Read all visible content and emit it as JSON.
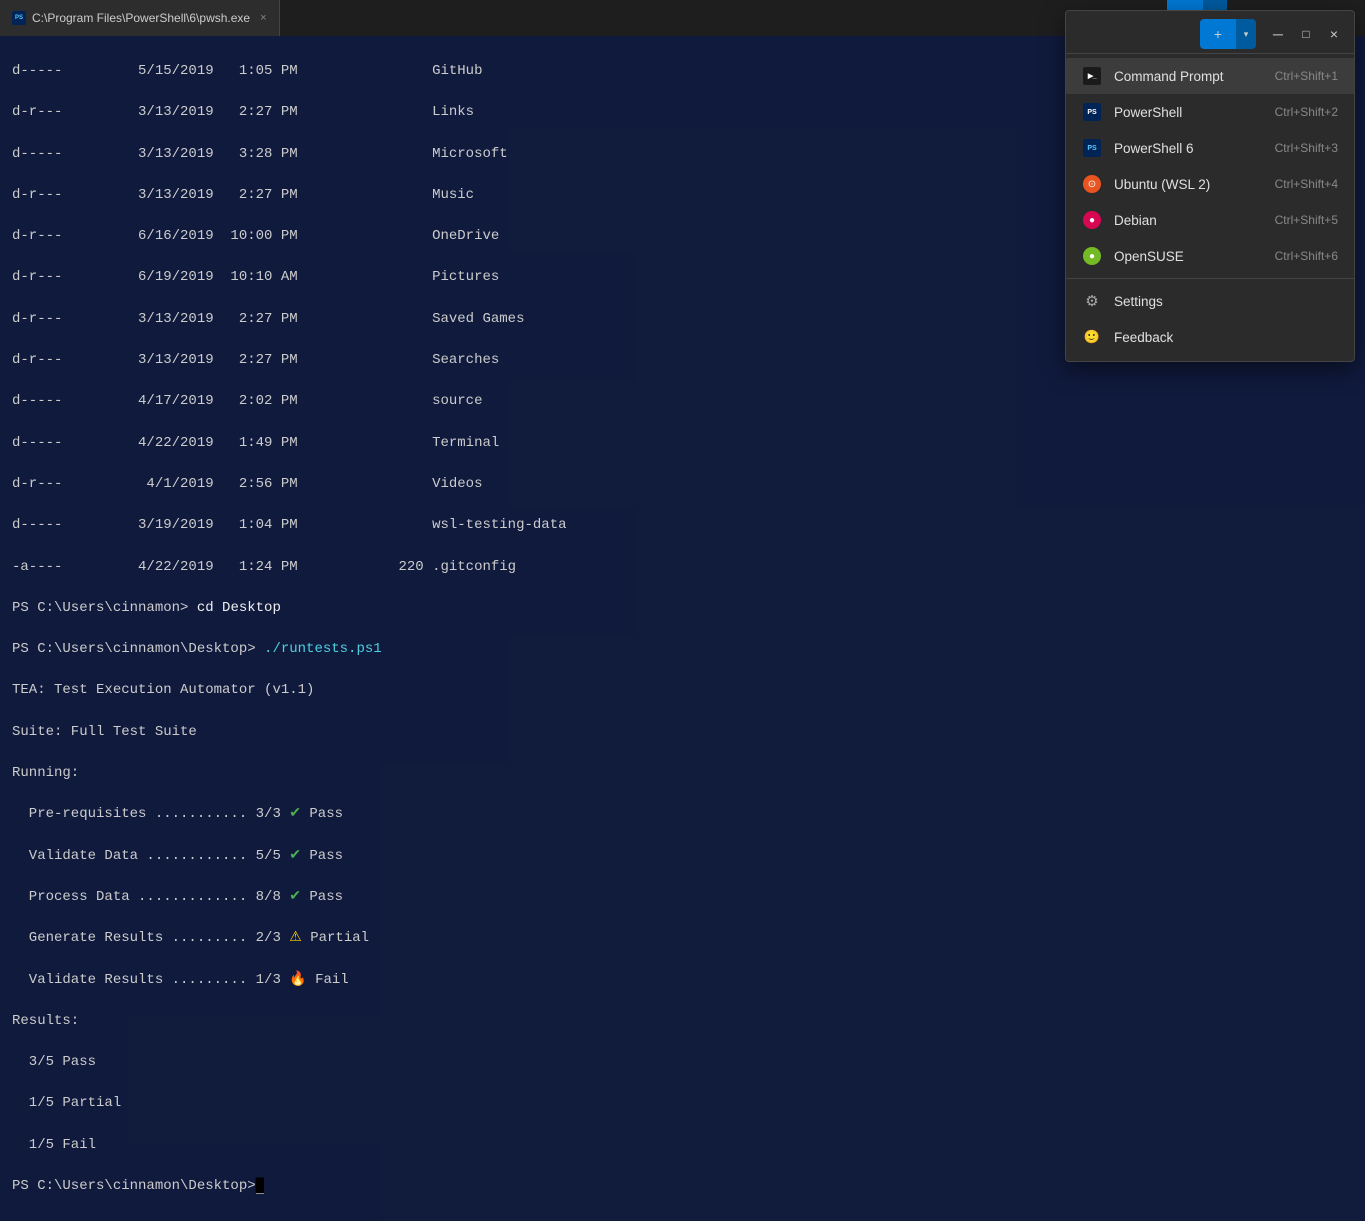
{
  "window": {
    "title": "C:\\Program Files\\PowerShell\\6\\pwsh.exe",
    "close_label": "×"
  },
  "topbar": {
    "tab_label": "C:\\Program Files\\PowerShell\\6\\pwsh.exe",
    "new_tab_label": "+",
    "chevron_label": "˅",
    "minimize_label": "─",
    "maximize_label": "□",
    "close_label": "×"
  },
  "terminal": {
    "lines": [
      "d-----         5/15/2019   1:05 PM                GitHub",
      "d-r---         3/13/2019   2:27 PM                Links",
      "d-----         3/13/2019   3:28 PM                Microsoft",
      "d-r---         3/13/2019   2:27 PM                Music",
      "d-r---         6/16/2019  10:00 PM                OneDrive",
      "d-r---         6/19/2019  10:10 AM                Pictures",
      "d-r---         3/13/2019   2:27 PM                Saved Games",
      "d-r---         3/13/2019   2:27 PM                Searches",
      "d-----         4/17/2019   2:02 PM                source",
      "d-----         4/22/2019   1:49 PM                Terminal",
      "d-r---          4/1/2019   2:56 PM                Videos",
      "d-----         3/19/2019   1:04 PM                wsl-testing-data",
      "-a----         4/22/2019   1:24 PM            220 .gitconfig"
    ],
    "prompt1": "PS C:\\Users\\cinnamon> cd Desktop",
    "prompt2": "PS C:\\Users\\cinnamon\\Desktop> ./runtests.ps1",
    "tea_line": "TEA: Test Execution Automator (v1.1)",
    "suite_line": "Suite: Full Test Suite",
    "running_line": "Running:",
    "test_results": [
      {
        "label": "  Pre-requisites ........... 3/3",
        "icon": "✔",
        "status": "Pass"
      },
      {
        "label": "  Validate Data ............ 5/5",
        "icon": "✔",
        "status": "Pass"
      },
      {
        "label": "  Process Data ............. 8/8",
        "icon": "✔",
        "status": "Pass"
      },
      {
        "label": "  Generate Results ......... 2/3",
        "icon": "⚠",
        "status": "Partial"
      },
      {
        "label": "  Validate Results ......... 1/3",
        "icon": "🔥",
        "status": "Fail"
      }
    ],
    "results_header": "Results:",
    "result_pass": "  3/5 Pass",
    "result_partial": "  1/5 Partial",
    "result_fail": "  1/5 Fail",
    "final_prompt": "PS C:\\Users\\cinnamon\\Desktop>"
  },
  "dropdown": {
    "items": [
      {
        "id": "cmd",
        "label": "Command Prompt",
        "shortcut": "Ctrl+Shift+1",
        "icon_type": "cmd"
      },
      {
        "id": "ps",
        "label": "PowerShell",
        "shortcut": "Ctrl+Shift+2",
        "icon_type": "ps"
      },
      {
        "id": "ps6",
        "label": "PowerShell 6",
        "shortcut": "Ctrl+Shift+3",
        "icon_type": "ps6"
      },
      {
        "id": "ubuntu",
        "label": "Ubuntu (WSL 2)",
        "shortcut": "Ctrl+Shift+4",
        "icon_type": "ubuntu"
      },
      {
        "id": "debian",
        "label": "Debian",
        "shortcut": "Ctrl+Shift+5",
        "icon_type": "debian"
      },
      {
        "id": "opensuse",
        "label": "OpenSUSE",
        "shortcut": "Ctrl+Shift+6",
        "icon_type": "opensuse"
      }
    ],
    "settings_label": "Settings",
    "feedback_label": "Feedback"
  }
}
